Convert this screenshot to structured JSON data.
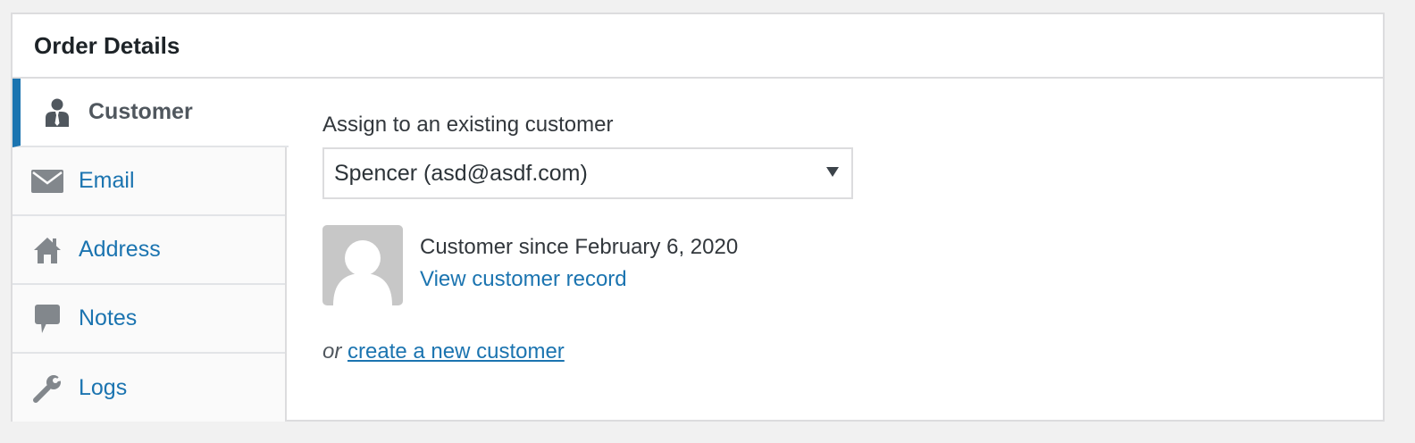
{
  "panel": {
    "title": "Order Details"
  },
  "tabs": [
    {
      "label": "Customer",
      "icon": "user-icon",
      "active": true
    },
    {
      "label": "Email",
      "icon": "envelope-icon",
      "active": false
    },
    {
      "label": "Address",
      "icon": "home-icon",
      "active": false
    },
    {
      "label": "Notes",
      "icon": "speech-bubble-icon",
      "active": false
    },
    {
      "label": "Logs",
      "icon": "wrench-icon",
      "active": false
    }
  ],
  "customer": {
    "assign_label": "Assign to an existing customer",
    "selected_customer": "Spencer (asd@asdf.com)",
    "since_text": "Customer since February 6, 2020",
    "view_record_label": "View customer record",
    "or_text": "or",
    "create_label": "create a new customer"
  },
  "colors": {
    "link": "#1b74b0",
    "active_border": "#1b74b0",
    "icon_gray": "#82878c",
    "avatar_bg": "#c7c7c7"
  }
}
